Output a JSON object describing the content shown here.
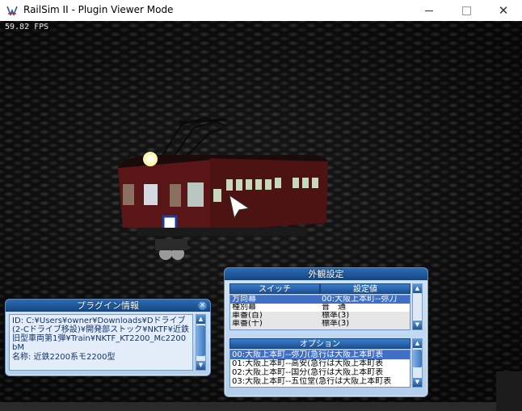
{
  "window": {
    "title": "RailSim II - Plugin Viewer Mode"
  },
  "viewport": {
    "fps": "59.82 FPS"
  },
  "plugin_info": {
    "title": "プラグイン情報",
    "id_text": "ID: C:¥Users¥owner¥Downloads¥Dドライブ(2-Cドライブ移設)¥開発部ストック¥NKTF¥近鉄旧型車両第1弾¥Train¥NKTF_KT2200_Mc2200bM",
    "name_text": "名称: 近鉄2200系モ2200型"
  },
  "appearance": {
    "title": "外観設定",
    "col_switch": "スイッチ",
    "col_value": "設定値",
    "rows": [
      {
        "switch": "方向幕",
        "value": "00:大阪上本町--弥刀"
      },
      {
        "switch": "種別幕",
        "value": "普　通"
      },
      {
        "switch": "車番(百)",
        "value": "標準(3)"
      },
      {
        "switch": "車番(十)",
        "value": "標準(3)"
      }
    ],
    "options_label": "オプション",
    "options": [
      "00:大阪上本町--弥刀(急行は大阪上本町表",
      "01:大阪上本町--高安(急行は大阪上本町表",
      "02:大阪上本町--国分(急行は大阪上本町表",
      "03:大阪上本町--五位堂(急行は大阪上本町表"
    ]
  },
  "icons": {
    "app": "railsim-app-icon",
    "close": "close-icon",
    "scroll_up": "scroll-up-arrow-icon",
    "scroll_down": "scroll-down-arrow-icon"
  },
  "colors": {
    "panel_title": "#15457f",
    "selection": "#3f6fc7",
    "train_body": "#5a1616"
  }
}
